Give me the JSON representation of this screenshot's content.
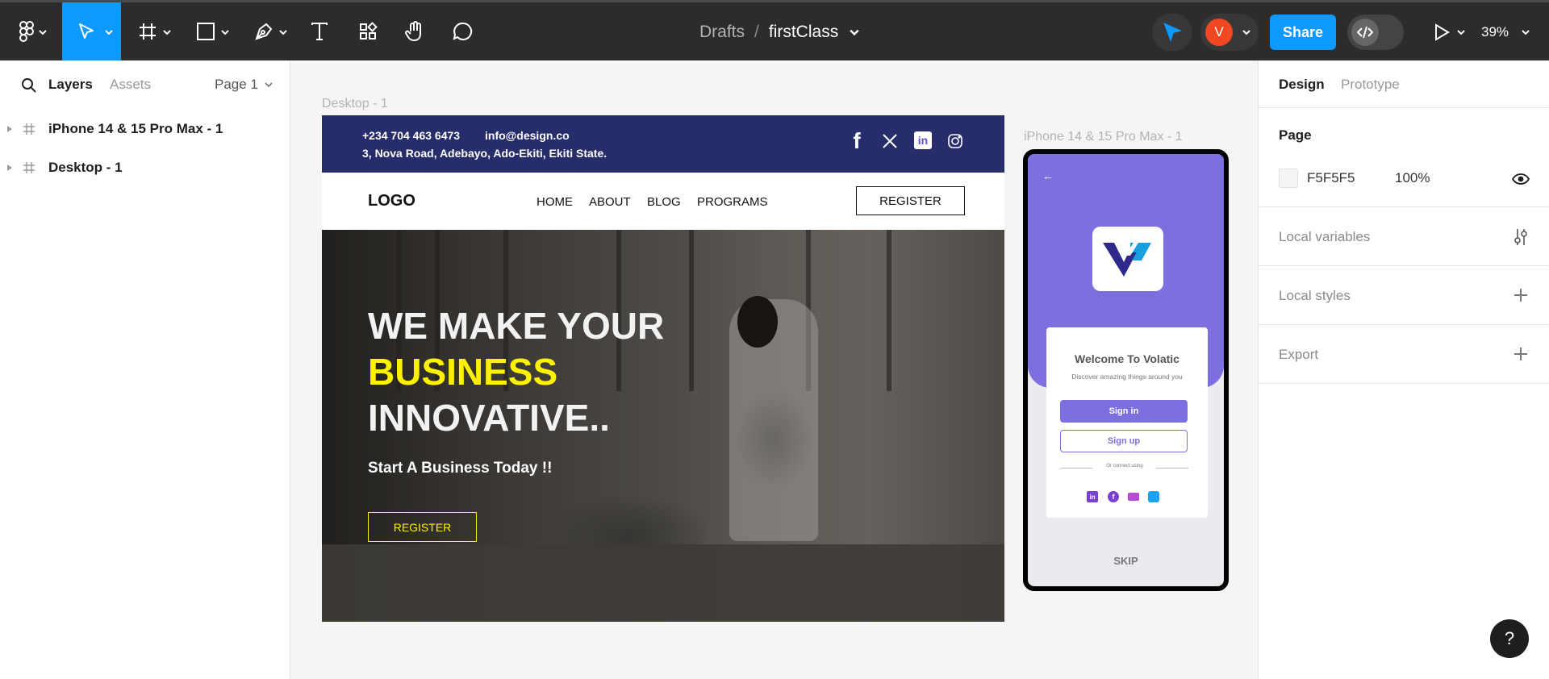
{
  "toolbar": {
    "breadcrumb_folder": "Drafts",
    "breadcrumb_sep": "/",
    "file_name": "firstClass",
    "share_label": "Share",
    "avatar_initial": "V",
    "zoom": "39%",
    "active_tool": "move",
    "colors": {
      "bg": "#2c2c2c",
      "accent": "#0d99ff",
      "avatar": "#f24822"
    }
  },
  "left_panel": {
    "tab_layers": "Layers",
    "tab_assets": "Assets",
    "page_selector": "Page 1",
    "layers": [
      {
        "name": "iPhone 14 & 15 Pro Max - 1"
      },
      {
        "name": "Desktop - 1"
      }
    ]
  },
  "canvas": {
    "desktop_label": "Desktop - 1",
    "phone_label": "iPhone 14 & 15 Pro Max - 1",
    "desktop": {
      "phone": "+234 704 463 6473",
      "email": "info@design.co",
      "address": "3, Nova Road, Adebayo, Ado-Ekiti, Ekiti State.",
      "logo": "LOGO",
      "nav": [
        "HOME",
        "ABOUT",
        "BLOG",
        "PROGRAMS"
      ],
      "register_button": "REGISTER",
      "hero_line1": "WE MAKE YOUR",
      "hero_line2": "BUSINESS",
      "hero_line3": "INNOVATIVE..",
      "hero_sub": "Start A Business Today !!",
      "hero_button": "REGISTER",
      "colors": {
        "topbar": "#272d6b",
        "highlight": "#fff200"
      }
    },
    "phone": {
      "back_arrow": "←",
      "welcome_title": "Welcome To Volatic",
      "welcome_sub": "Discover amazing things around you",
      "signin": "Sign in",
      "signup": "Sign up",
      "connect_text": "Or connect using",
      "skip": "SKIP",
      "colors": {
        "purple": "#7c6fe0",
        "brand": "#2d2a8c"
      }
    }
  },
  "right_panel": {
    "tab_design": "Design",
    "tab_prototype": "Prototype",
    "page_heading": "Page",
    "page_color": "F5F5F5",
    "page_opacity": "100%",
    "local_variables": "Local variables",
    "local_styles": "Local styles",
    "export": "Export",
    "help": "?"
  }
}
